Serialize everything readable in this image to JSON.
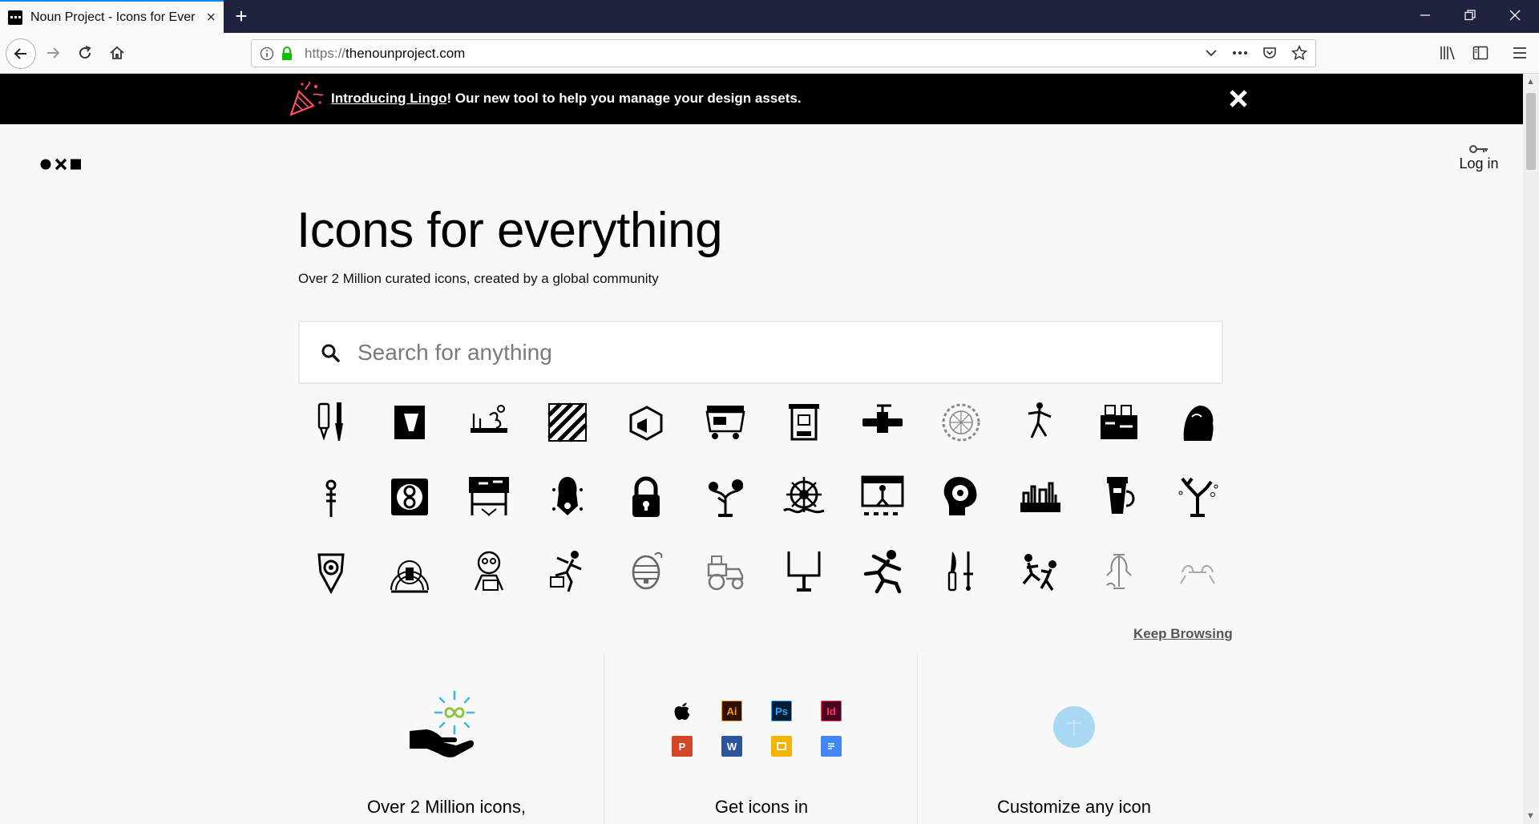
{
  "browser": {
    "tab_title": "Noun Project - Icons for Ever",
    "url_scheme": "https://",
    "url_host": "thenounproject.com"
  },
  "banner": {
    "link_text": "Introducing Lingo",
    "message": "! Our new tool to help you manage your design assets."
  },
  "header": {
    "login_label": "Log in"
  },
  "hero": {
    "title": "Icons for everything",
    "subtitle": "Over 2 Million curated icons, created by a global community"
  },
  "search": {
    "placeholder": "Search for anything"
  },
  "icon_grid": {
    "icons": [
      "paint-tube-brush-icon",
      "book-page-icon",
      "garden-tools-icon",
      "crosswalk-pattern-icon",
      "megaphone-device-icon",
      "food-truck-icon",
      "dam-gate-icon",
      "valve-pipe-icon",
      "gear-wheel-icon",
      "dancing-figure-icon",
      "construction-site-icon",
      "sphinx-statue-icon",
      "chinese-knot-icon",
      "circle-frame-icon",
      "workbench-icon",
      "fountain-pen-icon",
      "padlock-icon",
      "bonsai-tree-icon",
      "ship-wheel-icon",
      "stage-performer-icon",
      "head-gear-icon",
      "city-skyline-icon",
      "vase-handle-icon",
      "coral-plant-icon",
      "shield-emblem-icon",
      "fist-badge-icon",
      "person-reading-icon",
      "jumping-man-icon",
      "beehive-icon",
      "tractor-icon",
      "goal-post-icon",
      "running-man-icon",
      "knife-sword-icon",
      "fighting-figures-icon",
      "hands-holding-icon",
      "hands-stretch-icon"
    ]
  },
  "keep_browsing_label": "Keep Browsing",
  "features": [
    {
      "title": "Over 2 Million icons,"
    },
    {
      "title": "Get icons in"
    },
    {
      "title": "Customize any icon"
    }
  ],
  "apps": [
    "Ai",
    "Ps",
    "Id",
    "P",
    "W",
    "",
    ""
  ],
  "colors": {
    "tabstrip": "#202340",
    "banner": "#000000",
    "illustrator": "#ff9a00",
    "photoshop": "#31a8ff",
    "indesign": "#ff3366",
    "powerpoint": "#d24726",
    "word": "#2b579a",
    "slides": "#f4b400",
    "docs": "#4285f4"
  }
}
